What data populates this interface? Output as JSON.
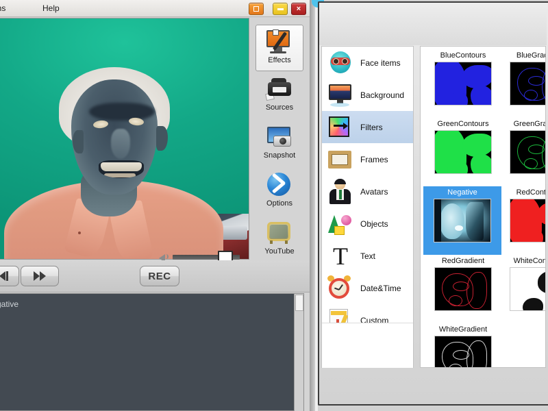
{
  "left_window": {
    "menu": [
      {
        "label": "tions",
        "name": "menu-options"
      },
      {
        "label": "Help",
        "name": "menu-help"
      }
    ],
    "window_buttons": {
      "restore_label": "",
      "minimize_label": "",
      "close_label": "×"
    },
    "tools": [
      {
        "label": "Effects",
        "icon": "effects-icon",
        "selected": true
      },
      {
        "label": "Sources",
        "icon": "sources-icon",
        "selected": false
      },
      {
        "label": "Snapshot",
        "icon": "snapshot-icon",
        "selected": false
      },
      {
        "label": "Options",
        "icon": "options-icon",
        "selected": false
      },
      {
        "label": "YouTube",
        "icon": "youtube-icon",
        "selected": false
      }
    ],
    "transport": {
      "prev_label": "",
      "forward_label": "",
      "record_label": "REC"
    },
    "volume": {
      "icon": "speaker-icon",
      "value": 80
    },
    "log": {
      "text": "gative"
    }
  },
  "right_window": {
    "categories": [
      {
        "label": "Face items",
        "icon": "face-mask-icon",
        "selected": false
      },
      {
        "label": "Background",
        "icon": "monitor-icon",
        "selected": false
      },
      {
        "label": "Filters",
        "icon": "color-square-icon",
        "selected": true
      },
      {
        "label": "Frames",
        "icon": "picture-frame-icon",
        "selected": false
      },
      {
        "label": "Avatars",
        "icon": "person-icon",
        "selected": false
      },
      {
        "label": "Objects",
        "icon": "shapes-icon",
        "selected": false
      },
      {
        "label": "Text",
        "icon": "letter-t-icon",
        "selected": false
      },
      {
        "label": "Date&Time",
        "icon": "alarm-clock-icon",
        "selected": false
      },
      {
        "label": "Custom",
        "icon": "document-edit-icon",
        "selected": false
      }
    ],
    "effects": [
      {
        "label": "BlueContours",
        "style": "solid",
        "color": "#2222e0",
        "selected": false
      },
      {
        "label": "BlueGradient",
        "style": "line",
        "color": "#2b2bd8",
        "selected": false
      },
      {
        "label": "GreenContours",
        "style": "solid",
        "color": "#1fe048",
        "selected": false
      },
      {
        "label": "GreenGradient",
        "style": "line",
        "color": "#1bb83c",
        "selected": false
      },
      {
        "label": "Negative",
        "style": "photo",
        "color": "#9fd9e8",
        "selected": true
      },
      {
        "label": "RedContours",
        "style": "solid",
        "color": "#ef2020",
        "selected": false
      },
      {
        "label": "RedGradient",
        "style": "line",
        "color": "#c62030",
        "selected": false
      },
      {
        "label": "WhiteContours",
        "style": "invert",
        "color": "#ffffff",
        "selected": false
      },
      {
        "label": "WhiteGradient",
        "style": "line",
        "color": "#d8d8d8",
        "selected": false
      }
    ]
  }
}
